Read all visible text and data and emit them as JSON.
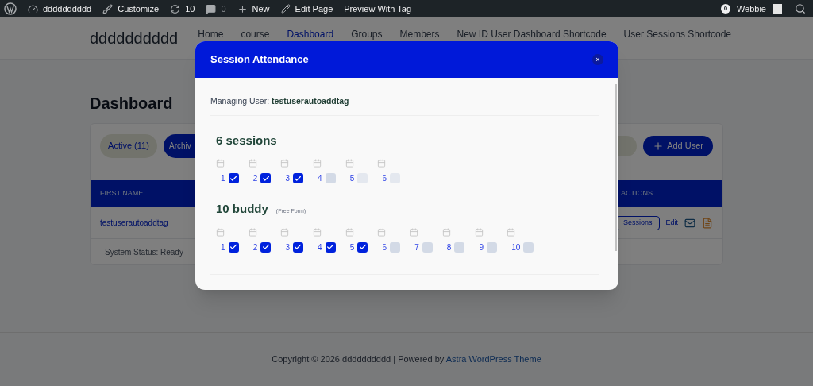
{
  "admin_bar": {
    "site": "dddddddddd",
    "customize": "Customize",
    "updates": "10",
    "comments": "0",
    "new": "New",
    "edit_page": "Edit Page",
    "preview": "Preview With Tag",
    "notifications": "0",
    "user": "Webbie"
  },
  "header": {
    "site_title": "dddddddddd",
    "nav": [
      {
        "label": "Home",
        "selected": false
      },
      {
        "label": "course",
        "selected": false
      },
      {
        "label": "Dashboard",
        "selected": true
      },
      {
        "label": "Groups",
        "selected": false
      },
      {
        "label": "Members",
        "selected": false
      },
      {
        "label": "New ID User Dashboard Shortcode",
        "selected": false
      },
      {
        "label": "User Sessions Shortcode",
        "selected": false
      }
    ]
  },
  "page_title": "Dashboard",
  "filters": [
    {
      "label": "Active (11)",
      "selected": true
    },
    {
      "label": "Archiv",
      "selected": false
    }
  ],
  "add_user": "Add User",
  "table": {
    "columns": [
      "FIRST NAME",
      "ACTIONS"
    ],
    "rows": [
      {
        "first_name": "testuserautoaddtag",
        "sessions": "Sessions",
        "edit": "Edit"
      }
    ]
  },
  "status": "System Status: Ready",
  "footer": {
    "text": "Copyright © 2026 dddddddddd | Powered by",
    "link": "Astra WordPress Theme"
  },
  "modal": {
    "title": "Session Attendance",
    "close": "×",
    "managing_label": "Managing User:",
    "managing_user": "testuserautoaddtag",
    "groups": [
      {
        "name": "6 sessions",
        "sessions": [
          {
            "number": "1",
            "checked": true,
            "disabled": false
          },
          {
            "number": "2",
            "checked": true,
            "disabled": false
          },
          {
            "number": "3",
            "checked": true,
            "disabled": false
          },
          {
            "number": "4",
            "checked": false,
            "disabled": false
          },
          {
            "number": "5",
            "checked": false,
            "disabled": true
          },
          {
            "number": "6",
            "checked": false,
            "disabled": true
          }
        ]
      },
      {
        "name": "10 buddy",
        "note": "(Free Form)",
        "sessions": [
          {
            "number": "1",
            "checked": true,
            "disabled": false
          },
          {
            "number": "2",
            "checked": true,
            "disabled": false
          },
          {
            "number": "3",
            "checked": true,
            "disabled": false
          },
          {
            "number": "4",
            "checked": true,
            "disabled": false
          },
          {
            "number": "5",
            "checked": true,
            "disabled": false
          },
          {
            "number": "6",
            "checked": false,
            "disabled": false
          },
          {
            "number": "7",
            "checked": false,
            "disabled": false
          },
          {
            "number": "8",
            "checked": false,
            "disabled": false
          },
          {
            "number": "9",
            "checked": false,
            "disabled": false
          },
          {
            "number": "10",
            "checked": false,
            "disabled": false
          }
        ]
      }
    ]
  }
}
